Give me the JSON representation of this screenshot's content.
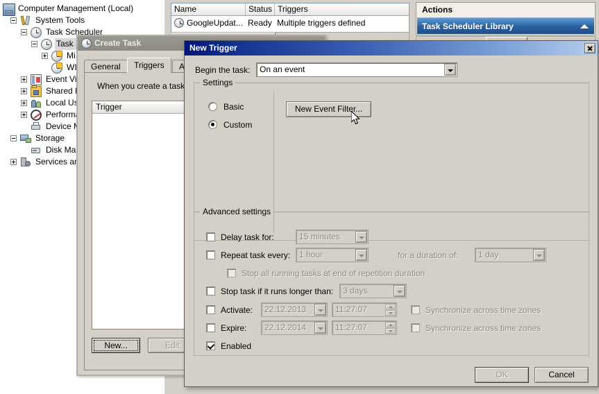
{
  "mmc": {
    "tree": [
      {
        "label": "Computer Management (Local)",
        "icon": "computer-icon",
        "indent": 0,
        "toggle": "none",
        "selected": false
      },
      {
        "label": "System Tools",
        "icon": "tools-icon",
        "indent": 1,
        "toggle": "minus",
        "selected": false
      },
      {
        "label": "Task Scheduler",
        "icon": "clock-icon",
        "indent": 2,
        "toggle": "minus",
        "selected": false
      },
      {
        "label": "Task S",
        "icon": "clock-icon",
        "indent": 3,
        "toggle": "minus",
        "selected": true
      },
      {
        "label": "Mi",
        "icon": "clock-folder-icon",
        "indent": 4,
        "toggle": "plus",
        "selected": false
      },
      {
        "label": "WI",
        "icon": "clock-folder-icon",
        "indent": 4,
        "toggle": "none",
        "selected": false
      },
      {
        "label": "Event View",
        "icon": "event-viewer-icon",
        "indent": 2,
        "toggle": "plus",
        "selected": false
      },
      {
        "label": "Shared Fo",
        "icon": "shared-folders-icon",
        "indent": 2,
        "toggle": "plus",
        "selected": false
      },
      {
        "label": "Local User",
        "icon": "local-users-icon",
        "indent": 2,
        "toggle": "plus",
        "selected": false
      },
      {
        "label": "Performan",
        "icon": "performance-icon",
        "indent": 2,
        "toggle": "plus",
        "selected": false
      },
      {
        "label": "Device Ma",
        "icon": "device-manager-icon",
        "indent": 2,
        "toggle": "none",
        "selected": false
      },
      {
        "label": "Storage",
        "icon": "storage-icon",
        "indent": 1,
        "toggle": "minus",
        "selected": false
      },
      {
        "label": "Disk Mana",
        "icon": "disk-management-icon",
        "indent": 2,
        "toggle": "none",
        "selected": false
      },
      {
        "label": "Services and A",
        "icon": "services-icon",
        "indent": 1,
        "toggle": "plus",
        "selected": false
      }
    ],
    "list": {
      "columns": [
        "Name",
        "Status",
        "Triggers"
      ],
      "rows": [
        {
          "name": "GoogleUpdat...",
          "status": "Ready",
          "triggers": "Multiple triggers defined"
        }
      ]
    },
    "actions": {
      "title": "Actions",
      "selected_item": "Task Scheduler Library"
    }
  },
  "create_task": {
    "title": "Create Task",
    "tabs": [
      {
        "label": "General",
        "active": false
      },
      {
        "label": "Triggers",
        "active": true
      },
      {
        "label": "Actio",
        "active": false
      }
    ],
    "description": "When you create a task,",
    "grid_columns": [
      "Trigger"
    ],
    "buttons": {
      "new": "New...",
      "edit": "Edit"
    }
  },
  "new_trigger": {
    "title": "New Trigger",
    "begin_label": "Begin the task:",
    "begin_value": "On an event",
    "settings": {
      "legend": "Settings",
      "basic_label": "Basic",
      "custom_label": "Custom",
      "selected": "Custom",
      "new_event_filter_button": "New Event Filter..."
    },
    "advanced": {
      "legend": "Advanced settings",
      "delay_label": "Delay task for:",
      "delay_value": "15 minutes",
      "delay_checked": false,
      "repeat_label": "Repeat task every:",
      "repeat_value": "1 hour",
      "repeat_checked": false,
      "duration_label": "for a duration of:",
      "duration_value": "1 day",
      "stop_all_label": "Stop all running tasks at end of repetition duration",
      "stop_all_checked": false,
      "stop_task_label": "Stop task if it runs longer than:",
      "stop_task_value": "3 days",
      "stop_task_checked": false,
      "activate_label": "Activate:",
      "activate_date": "22.12.2013",
      "activate_time": "11:27:07",
      "activate_checked": false,
      "activate_sync_label": "Synchronize across time zones",
      "activate_sync_checked": false,
      "expire_label": "Expire:",
      "expire_date": "22.12.2014",
      "expire_time": "11:27:07",
      "expire_checked": false,
      "expire_sync_label": "Synchronize across time zones",
      "expire_sync_checked": false,
      "enabled_label": "Enabled",
      "enabled_checked": true
    },
    "ok_button": "OK",
    "cancel_button": "Cancel"
  },
  "colors": {
    "face": "#d4d0c8",
    "active_title_start": "#00157a",
    "active_title_end": "#b7cdec",
    "inactive_title": "#8b8b84",
    "actions_bar": "#2a5f9e",
    "disabled_text": "#8e8a81"
  }
}
